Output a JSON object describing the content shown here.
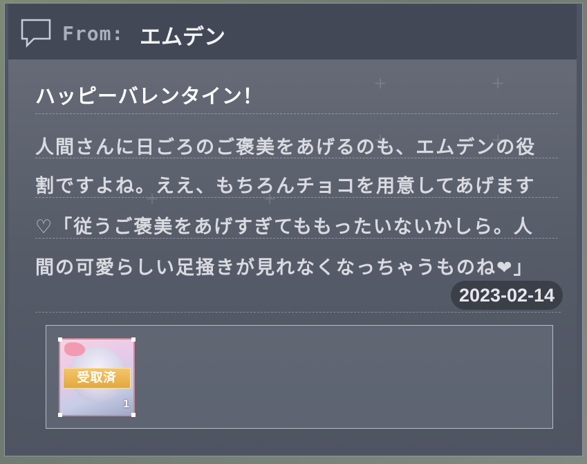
{
  "header": {
    "from_label": "From:",
    "sender": "エムデン",
    "icon": "chat-bubble-icon"
  },
  "message": {
    "subject": "ハッピーバレンタイン！",
    "lines": [
      "人間さんに日ごろのご褒美をあげるのも、エムデンの役",
      "割ですよね。ええ、もちろんチョコを用意してあげます",
      "♡「従うご褒美をあげすぎてももったいないかしら。人",
      "間の可愛らしい足掻きが見れなくなっちゃうものね❤」"
    ],
    "date": "2023-02-14"
  },
  "attachments": {
    "items": [
      {
        "status_label": "受取済",
        "quantity": "1",
        "icon": "character-reward-icon"
      }
    ]
  },
  "colors": {
    "panel_bg": "#4f5462",
    "header_bg": "#434856",
    "claimed_tag": "#e3a83d",
    "date_badge_bg": "#3b3f48"
  }
}
